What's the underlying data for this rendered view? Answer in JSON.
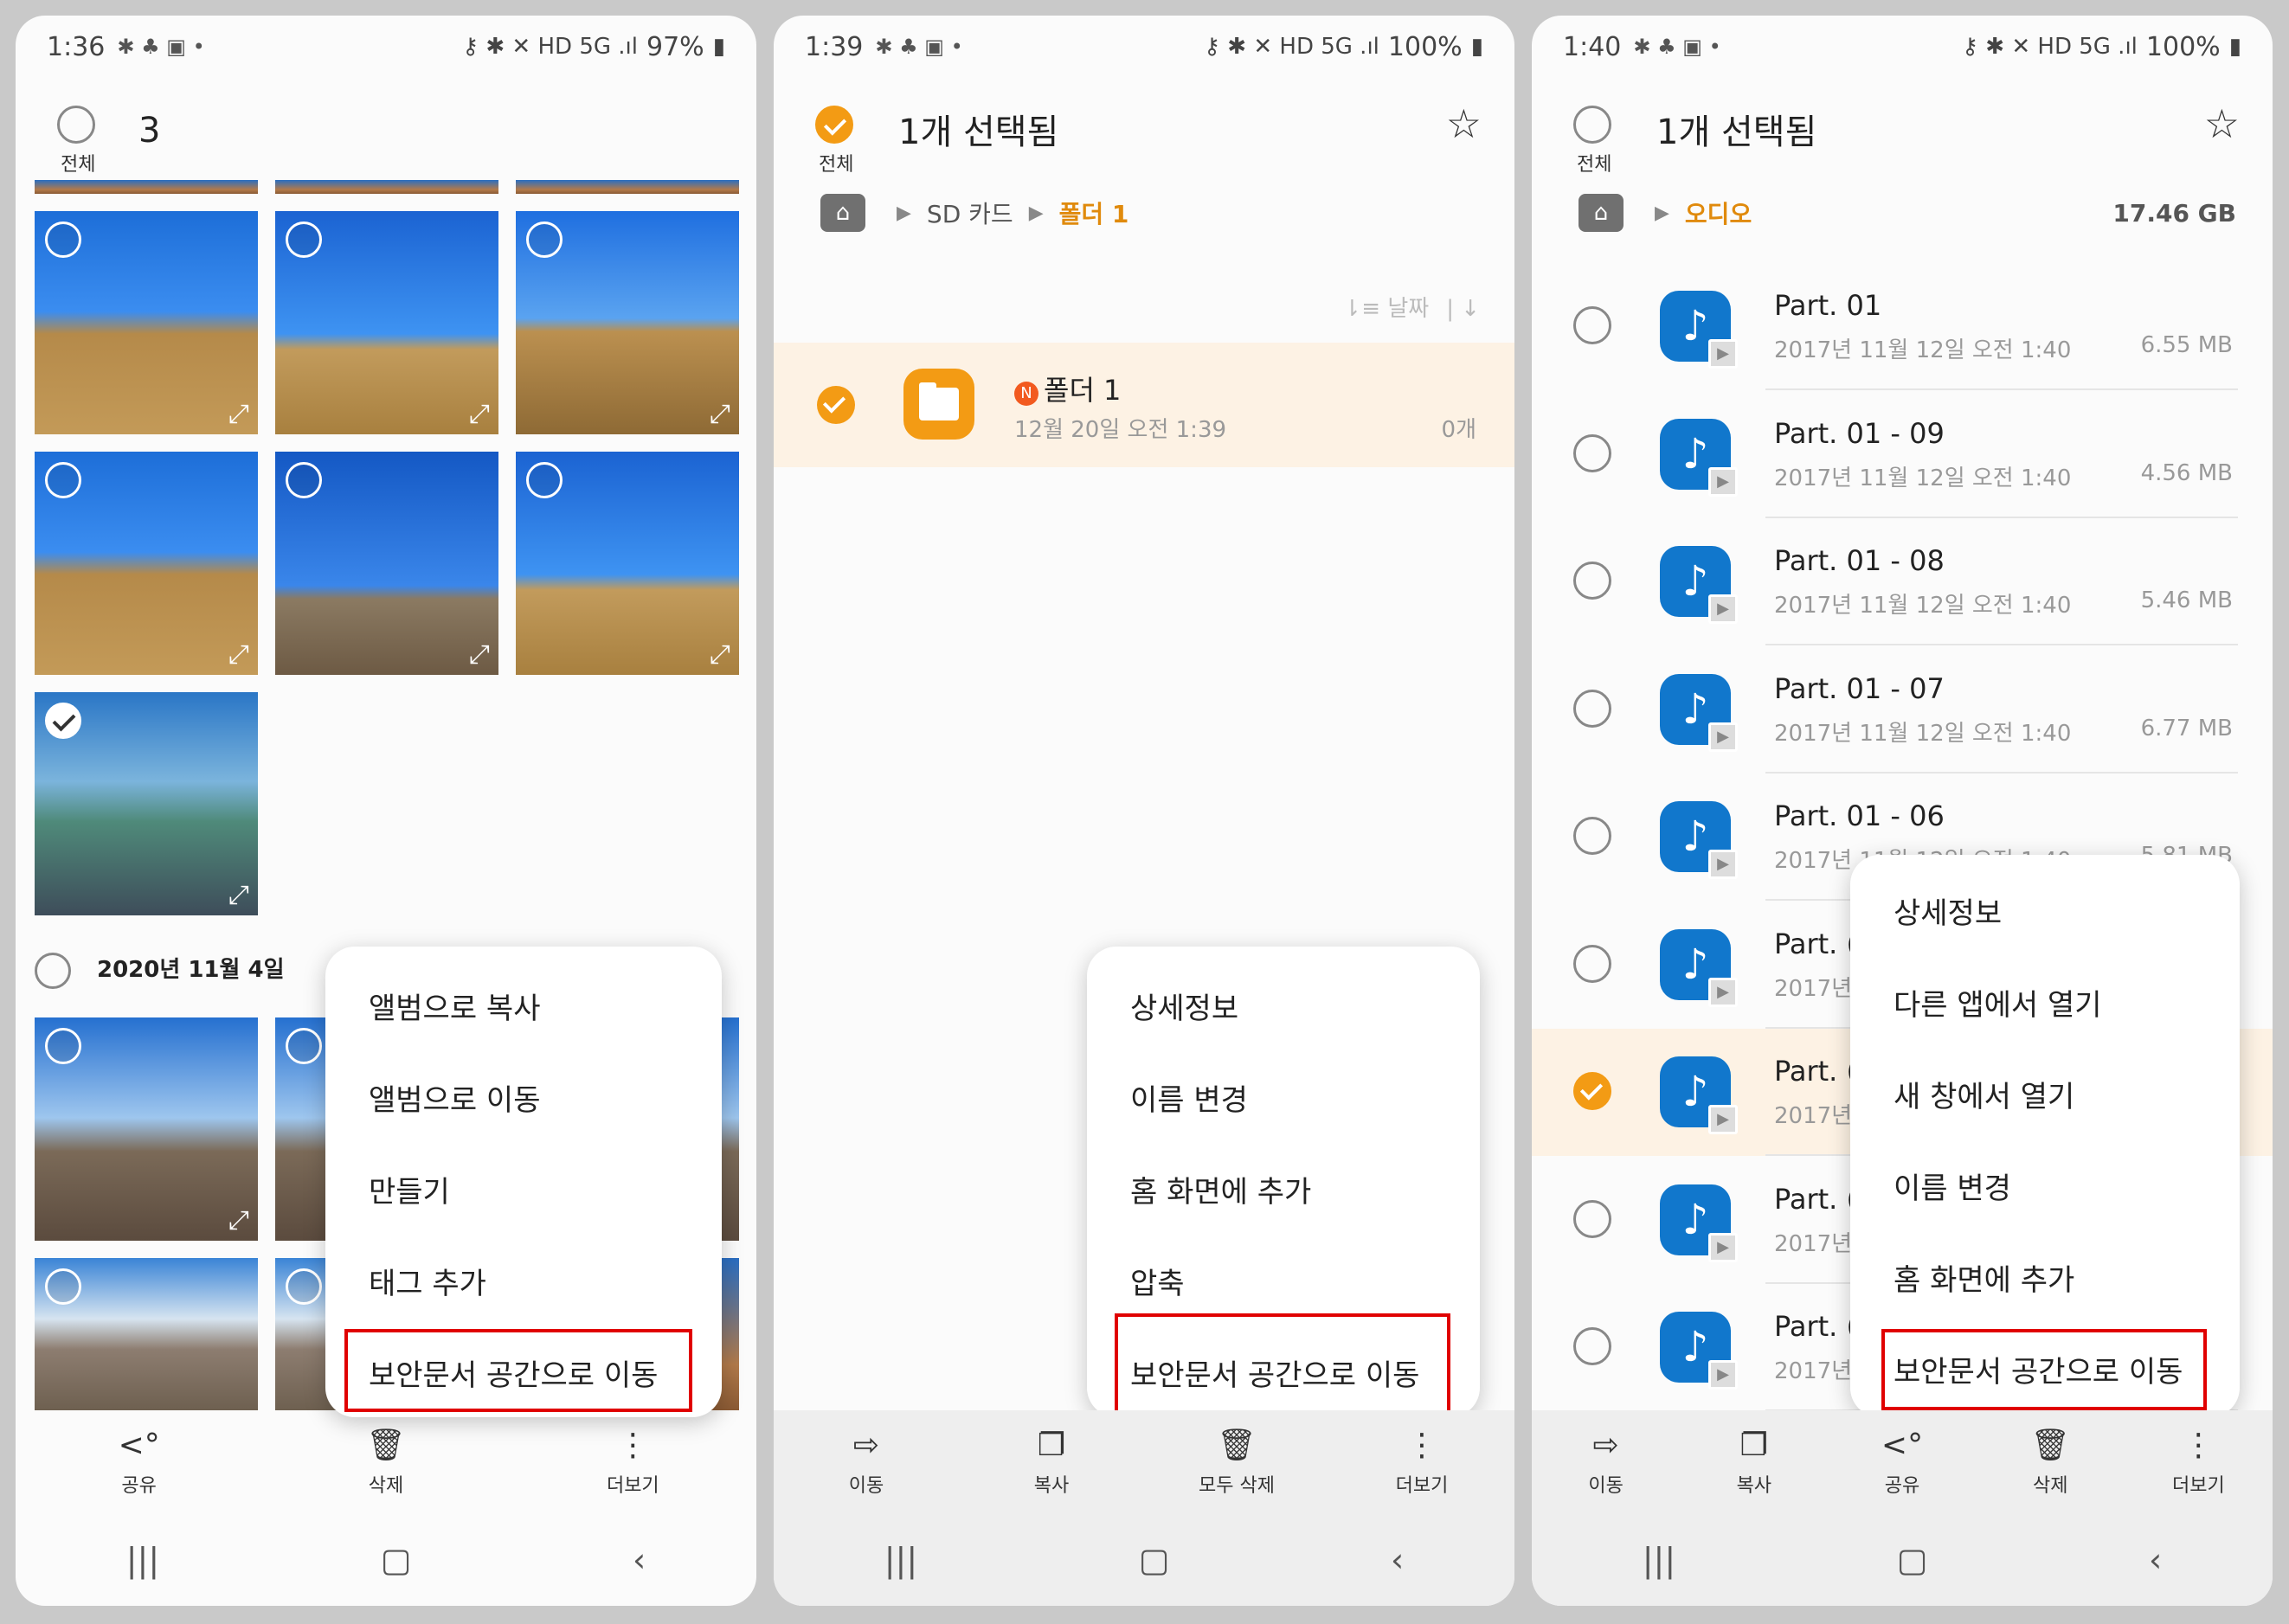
{
  "screens": [
    {
      "status": {
        "time": "1:36",
        "battery": "97%"
      },
      "header": {
        "count": "3",
        "all_label": "전체"
      },
      "date_group": "2020년 11월 4일",
      "menu": [
        "앨범으로 복사",
        "앨범으로 이동",
        "만들기",
        "태그 추가",
        "보안문서 공간으로 이동"
      ],
      "bottom": [
        {
          "icon": "share-icon",
          "label": "공유"
        },
        {
          "icon": "trash-icon",
          "label": "삭제"
        },
        {
          "icon": "more-icon",
          "label": "더보기"
        }
      ]
    },
    {
      "status": {
        "time": "1:39",
        "battery": "100%"
      },
      "header": {
        "title": "1개 선택됨",
        "all_label": "전체"
      },
      "breadcrumb": {
        "parent": "SD 카드",
        "current": "폴더 1"
      },
      "sort_label": "날짜",
      "folder": {
        "badge": "N",
        "name": "폴더 1",
        "date": "12월 20일 오전 1:39",
        "count": "0개"
      },
      "menu": [
        "상세정보",
        "이름 변경",
        "홈 화면에 추가",
        "압축",
        "보안문서 공간으로 이동"
      ],
      "bottom": [
        {
          "icon": "move-icon",
          "label": "이동"
        },
        {
          "icon": "copy-icon",
          "label": "복사"
        },
        {
          "icon": "trash-icon",
          "label": "모두 삭제"
        },
        {
          "icon": "more-icon",
          "label": "더보기"
        }
      ]
    },
    {
      "status": {
        "time": "1:40",
        "battery": "100%"
      },
      "header": {
        "title": "1개 선택됨",
        "all_label": "전체"
      },
      "breadcrumb": {
        "current": "오디오",
        "size": "17.46 GB"
      },
      "files": [
        {
          "name": "Part. 01",
          "date": "2017년 11월 12일 오전 1:40",
          "size": "6.55 MB",
          "selected": false
        },
        {
          "name": "Part. 01 - 09",
          "date": "2017년 11월 12일 오전 1:40",
          "size": "4.56 MB",
          "selected": false
        },
        {
          "name": "Part. 01 - 08",
          "date": "2017년 11월 12일 오전 1:40",
          "size": "5.46 MB",
          "selected": false
        },
        {
          "name": "Part. 01 - 07",
          "date": "2017년 11월 12일 오전 1:40",
          "size": "6.77 MB",
          "selected": false
        },
        {
          "name": "Part. 01 - 06",
          "date": "2017년 11월 12일 오전 1:40",
          "size": "5.81 MB",
          "selected": false
        },
        {
          "name": "Part. (",
          "date": "2017년",
          "size": "",
          "selected": false
        },
        {
          "name": "Part. (",
          "date": "2017년",
          "size": "",
          "selected": true
        },
        {
          "name": "Part. (",
          "date": "2017년",
          "size": "",
          "selected": false
        },
        {
          "name": "Part. (",
          "date": "2017년",
          "size": "",
          "selected": false
        }
      ],
      "menu": [
        "상세정보",
        "다른 앱에서 열기",
        "새 창에서 열기",
        "이름 변경",
        "홈 화면에 추가",
        "보안문서 공간으로 이동"
      ],
      "bottom": [
        {
          "icon": "move-icon",
          "label": "이동"
        },
        {
          "icon": "copy-icon",
          "label": "복사"
        },
        {
          "icon": "share-icon",
          "label": "공유"
        },
        {
          "icon": "trash-icon",
          "label": "삭제"
        },
        {
          "icon": "more-icon",
          "label": "더보기"
        }
      ]
    }
  ],
  "colors": {
    "accent": "#f39b14",
    "highlight_box": "#e00000",
    "audio_icon": "#1177cc"
  }
}
